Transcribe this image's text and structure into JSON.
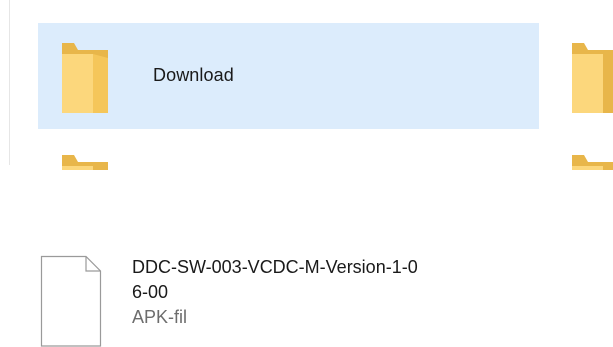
{
  "folders": [
    {
      "label": "Download",
      "icon": "folder-icon",
      "state": "selected"
    },
    {
      "label": "",
      "icon": "folder-icon"
    },
    {
      "label": "",
      "icon": "folder-icon"
    },
    {
      "label": "",
      "icon": "folder-icon"
    }
  ],
  "file": {
    "name": "DDC-SW-003-VCDC-M-Version-1-0\n6-00",
    "type": "APK-fil",
    "icon": "file-icon"
  },
  "colors": {
    "selection": "#dcecfc",
    "folder_light": "#fcd77c",
    "folder_dark": "#e8b64a",
    "text": "#1a1a1a",
    "muted_text": "#6d6d6d"
  }
}
